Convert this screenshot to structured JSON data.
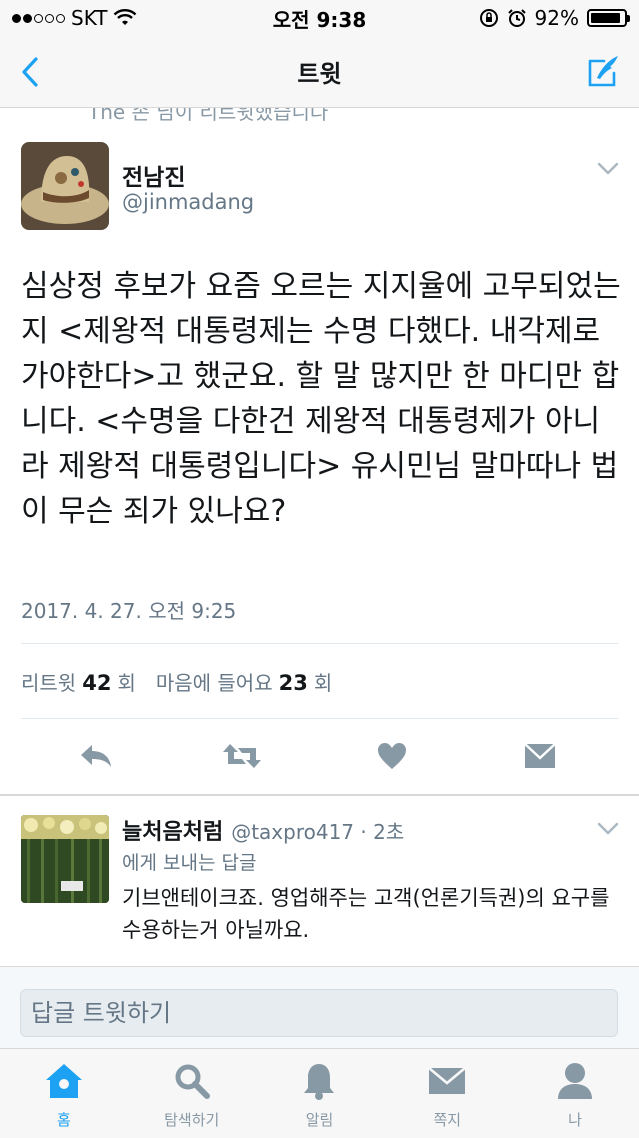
{
  "status_bar": {
    "carrier": "SKT",
    "time": "오전 9:38",
    "battery": "92%",
    "battery_level": 0.92
  },
  "nav": {
    "title": "트윗"
  },
  "retweet_peek": "The 손 님이 리트윗했습니다",
  "tweet": {
    "author_name": "전남진",
    "author_handle": "@jinmadang",
    "text": "심상정 후보가 요즘 오르는 지지율에 고무되었는지 <제왕적 대통령제는 수명 다했다. 내각제로 가야한다>고 했군요. 할 말 많지만 한 마디만 합니다. <수명을 다한건 제왕적 대통령제가 아니라 제왕적 대통령입니다> 유시민님 말마따나 법이 무슨 죄가 있나요?",
    "timestamp": "2017. 4. 27. 오전 9:25",
    "retweet_label": "리트윗",
    "retweet_count": "42",
    "retweet_suffix": "회",
    "like_label": "마음에 들어요",
    "like_count": "23",
    "like_suffix": "회"
  },
  "actions": {
    "reply_icon": "reply-icon",
    "retweet_icon": "retweet-icon",
    "like_icon": "heart-icon",
    "dm_icon": "envelope-icon"
  },
  "reply": {
    "name": "늘처음처럼",
    "handle": "@taxpro417 · 2초",
    "reply_to": "에게 보내는 답글",
    "text": "기브앤테이크죠. 영업해주는 고객(언론기득권)의 요구를 수용하는거 아닐까요."
  },
  "reply_box": {
    "placeholder": "답글 트윗하기"
  },
  "tabs": [
    {
      "label": "홈",
      "icon": "home-icon",
      "active": true
    },
    {
      "label": "탐색하기",
      "icon": "search-icon",
      "active": false
    },
    {
      "label": "알림",
      "icon": "bell-icon",
      "active": false
    },
    {
      "label": "쪽지",
      "icon": "envelope-icon",
      "active": false
    },
    {
      "label": "나",
      "icon": "person-icon",
      "active": false
    }
  ],
  "colors": {
    "accent": "#1da1f2",
    "icon_gray": "#8899a6",
    "text_gray": "#657786"
  }
}
